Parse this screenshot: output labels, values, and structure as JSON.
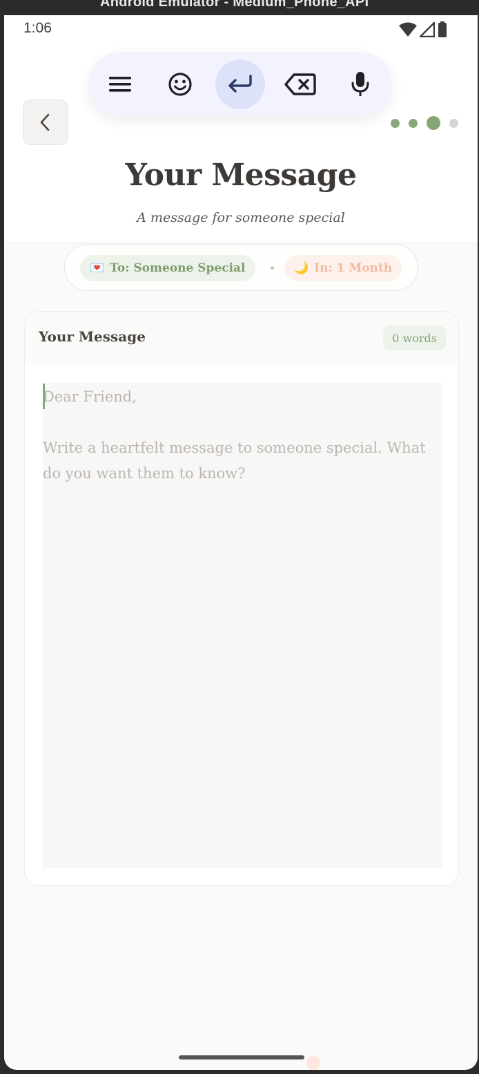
{
  "emulator": {
    "title": "Android Emulator - Medium_Phone_API"
  },
  "status_bar": {
    "time": "1:06",
    "icons": [
      "wifi-icon",
      "signal-icon",
      "battery-icon"
    ]
  },
  "header": {
    "title": "Your Message",
    "subtitle": "A message for someone special",
    "back_icon": "chevron-left-icon",
    "progress": {
      "total_steps": 4,
      "current_step": 3
    }
  },
  "keyboard_toolbar": {
    "buttons": [
      {
        "icon": "menu-icon"
      },
      {
        "icon": "emoji-icon"
      },
      {
        "icon": "enter-icon",
        "selected": true
      },
      {
        "icon": "backspace-icon"
      },
      {
        "icon": "microphone-icon"
      }
    ]
  },
  "chips": {
    "to": {
      "emoji": "💌",
      "label": "To: Someone Special"
    },
    "in": {
      "emoji": "🌙",
      "label": "In: 1 Month"
    }
  },
  "card": {
    "title": "Your Message",
    "word_count": "0 words",
    "placeholder": "Dear Friend,\n\nWrite a heartfelt message to someone special. What do you want them to know?"
  },
  "colors": {
    "accent_green": "#86a574",
    "accent_peach": "#f0bba0",
    "toolbar_bg": "#f3f3fd",
    "toolbar_selected": "#dde2fa"
  }
}
